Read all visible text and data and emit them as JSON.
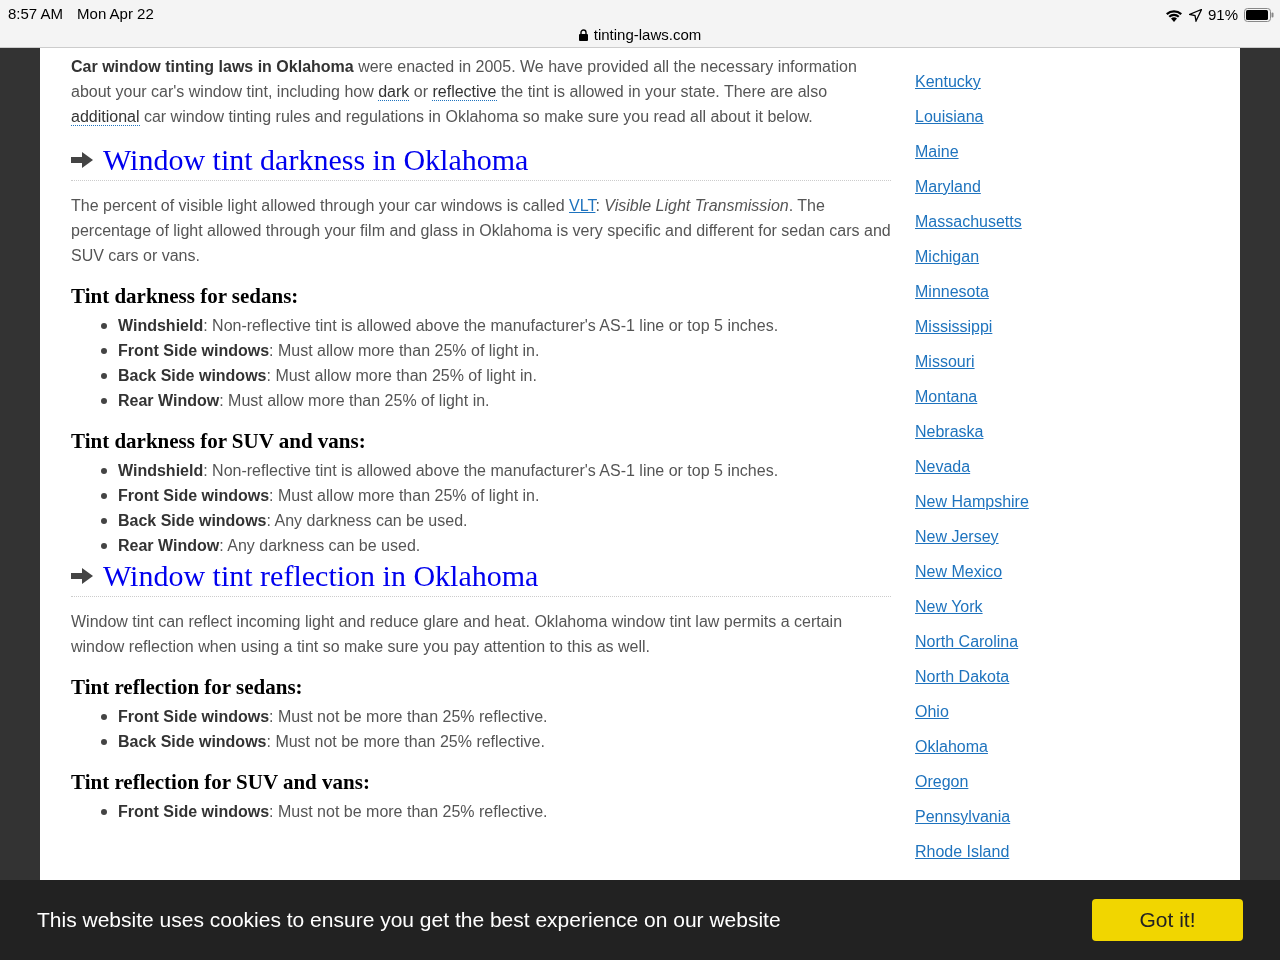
{
  "status_bar": {
    "time": "8:57 AM",
    "date": "Mon Apr 22",
    "url": "tinting-laws.com",
    "battery": "91%"
  },
  "article": [
    {
      "kind": "paragraph",
      "segments": [
        {
          "kind": "bold",
          "text": "Car window tinting laws in Oklahoma"
        },
        {
          "kind": "plain",
          "text": " were enacted in 2005. We have provided all the necessary information about your car's window tint, including how "
        },
        {
          "kind": "term",
          "text": "dark"
        },
        {
          "kind": "plain",
          "text": " or "
        },
        {
          "kind": "term",
          "text": "reflective"
        },
        {
          "kind": "plain",
          "text": " the tint is allowed in your state. There are also "
        },
        {
          "kind": "term",
          "text": "additional"
        },
        {
          "kind": "plain",
          "text": " car window tinting rules and regulations in Oklahoma so make sure you read all about it below."
        }
      ]
    },
    {
      "kind": "heading",
      "text": "Window tint darkness in Oklahoma"
    },
    {
      "kind": "paragraph",
      "segments": [
        {
          "kind": "plain",
          "text": "The percent of visible light allowed through your car windows is called "
        },
        {
          "kind": "link",
          "text": "VLT"
        },
        {
          "kind": "plain",
          "text": ": "
        },
        {
          "kind": "italic",
          "text": "Visible Light Transmission"
        },
        {
          "kind": "plain",
          "text": ". The percentage of light allowed through your film and glass in Oklahoma is very specific and different for sedan cars and SUV cars or vans."
        }
      ]
    },
    {
      "kind": "subheading",
      "text": "Tint darkness for sedans:"
    },
    {
      "kind": "list",
      "items": [
        {
          "term": "Windshield",
          "text": ": Non-reflective tint is allowed above the manufacturer's AS-1 line or top 5 inches."
        },
        {
          "term": "Front Side windows",
          "text": ": Must allow more than 25% of light in."
        },
        {
          "term": "Back Side windows",
          "text": ": Must allow more than 25% of light in."
        },
        {
          "term": "Rear Window",
          "text": ": Must allow more than 25% of light in."
        }
      ]
    },
    {
      "kind": "subheading",
      "text": "Tint darkness for SUV and vans:"
    },
    {
      "kind": "list",
      "items": [
        {
          "term": "Windshield",
          "text": ": Non-reflective tint is allowed above the manufacturer's AS-1 line or top 5 inches."
        },
        {
          "term": "Front Side windows",
          "text": ": Must allow more than 25% of light in."
        },
        {
          "term": "Back Side windows",
          "text": ": Any darkness can be used."
        },
        {
          "term": "Rear Window",
          "text": ": Any darkness can be used."
        }
      ]
    },
    {
      "kind": "heading",
      "text": "Window tint reflection in Oklahoma"
    },
    {
      "kind": "paragraph",
      "segments": [
        {
          "kind": "plain",
          "text": "Window tint can reflect incoming light and reduce glare and heat. Oklahoma window tint law permits a certain window reflection when using a tint so make sure you pay attention to this as well."
        }
      ]
    },
    {
      "kind": "subheading",
      "text": "Tint reflection for sedans:"
    },
    {
      "kind": "list",
      "items": [
        {
          "term": "Front Side windows",
          "text": ": Must not be more than 25% reflective."
        },
        {
          "term": "Back Side windows",
          "text": ": Must not be more than 25% reflective."
        }
      ]
    },
    {
      "kind": "subheading",
      "text": "Tint reflection for SUV and vans:"
    },
    {
      "kind": "list",
      "items": [
        {
          "term": "Front Side windows",
          "text": ": Must not be more than 25% reflective."
        }
      ]
    }
  ],
  "sidebar": {
    "states": [
      "Kentucky",
      "Louisiana",
      "Maine",
      "Maryland",
      "Massachusetts",
      "Michigan",
      "Minnesota",
      "Mississippi",
      "Missouri",
      "Montana",
      "Nebraska",
      "Nevada",
      "New Hampshire",
      "New Jersey",
      "New Mexico",
      "New York",
      "North Carolina",
      "North Dakota",
      "Ohio",
      "Oklahoma",
      "Oregon",
      "Pennsylvania",
      "Rhode Island"
    ]
  },
  "cookie_bar": {
    "message": "This website uses cookies to ensure you get the best experience on our website",
    "button": "Got it!"
  }
}
